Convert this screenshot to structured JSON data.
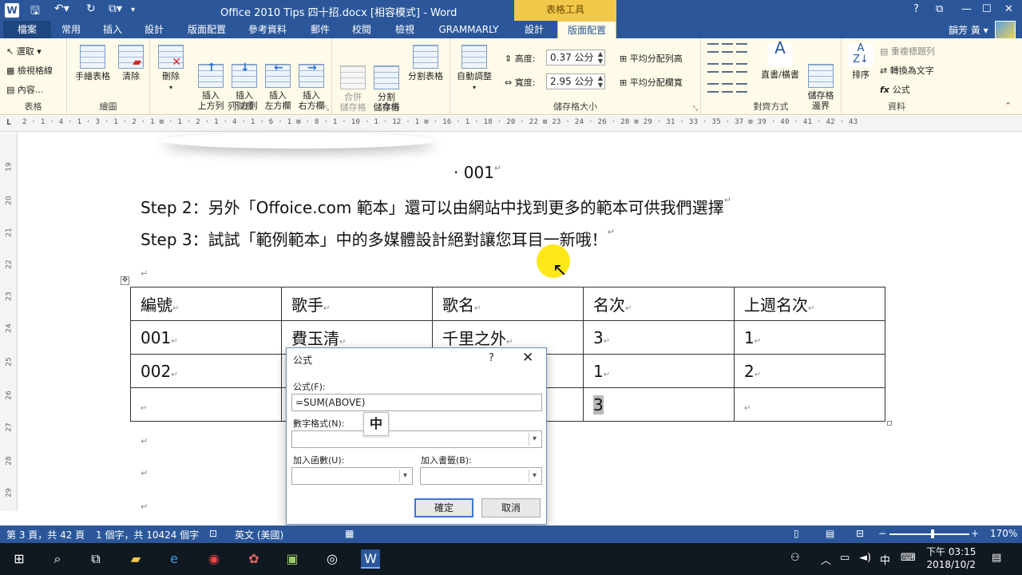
{
  "titlebar": {
    "title": "Office 2010 Tips 四十招.docx [相容模式] - Word",
    "tools_label": "表格工具",
    "help": "?",
    "restore": "⧉",
    "minimize": "—",
    "maximize": "☐",
    "close": "✕"
  },
  "tabs": {
    "file": "檔案",
    "home": "常用",
    "insert": "插入",
    "design": "設計",
    "layout": "版面配置",
    "references": "參考資料",
    "mailings": "郵件",
    "review": "校閱",
    "view": "檢視",
    "grammarly": "GRAMMARLY",
    "table_design": "設計",
    "table_layout": "版面配置",
    "user": "韻芳 黃 ▾"
  },
  "ribbon": {
    "select": "選取 ▾",
    "gridlines": "檢視格線",
    "properties": "內容...",
    "group_table": "表格",
    "draw_table": "手繪表格",
    "eraser": "清除",
    "group_draw": "繪圖",
    "delete": "刪除",
    "insert_above": "插入\n上方列",
    "insert_below": "插入\n下方列",
    "insert_left": "插入\n左方欄",
    "insert_right": "插入\n右方欄",
    "group_rows_cols": "列與欄",
    "merge_cells": "合併\n儲存格",
    "split_cells": "分割\n儲存格",
    "split_table": "分割表格",
    "group_merge": "合併",
    "autofit": "自動調整",
    "height_label": "高度:",
    "height_value": "0.37 公分",
    "width_label": "寬度:",
    "width_value": "2.95 公分",
    "distribute_rows": "平均分配列高",
    "distribute_cols": "平均分配欄寬",
    "group_cell_size": "儲存格大小",
    "text_direction": "直書/橫書",
    "cell_margins": "儲存格\n邊界",
    "group_alignment": "對齊方式",
    "sort": "排序",
    "repeat_header": "重複標題列",
    "convert_text": "轉換為文字",
    "formula": "公式",
    "group_data": "資料"
  },
  "ruler": {
    "text": "2 · 1 · 4 · 1 · 3 · 1 · 2 · 1 ⊞ · 1 · 2 · 1 · 4 · 1 · 6 · 1 ⊞ · 8 · 1 · 10 · 1 · 12 · 1 ⊞ · 16 · 1 · 18 · 20 · 22 ⊞ 23 · 24 · 26 · 28 ⊞ 29 · 31 · 33 · 35 · 37 ⊞ 39 · 40 · 41 · 42 · 43",
    "tab_stop": "L"
  },
  "vruler": [
    "19",
    "20",
    "21",
    "22",
    "23",
    "24",
    "25",
    "26",
    "27",
    "28",
    "29"
  ],
  "doc": {
    "caption": "001",
    "step2": "Step 2：另外「Offoice.com 範本」還可以由網站中找到更多的範本可供我們選擇",
    "step3": "Step 3：試試「範例範本」中的多媒體設計絕對讓您耳目一新哦！",
    "para_mark": "↵"
  },
  "table": {
    "header": [
      "編號",
      "歌手",
      "歌名",
      "名次",
      "上週名次"
    ],
    "rows": [
      [
        "001",
        "費玉清",
        "千里之外",
        "3",
        "1"
      ],
      [
        "002",
        "",
        "",
        "1",
        "2"
      ],
      [
        "",
        "",
        "",
        "3",
        ""
      ]
    ]
  },
  "dialog": {
    "title": "公式",
    "help": "?",
    "close": "✕",
    "formula_label": "公式(F):",
    "formula_value": "=SUM(ABOVE)",
    "number_format_label": "數字格式(N):",
    "number_format_value": "",
    "paste_function_label": "加入函數(U):",
    "paste_bookmark_label": "加入書籤(B):",
    "ok": "確定",
    "cancel": "取消",
    "ime": "中"
  },
  "status": {
    "page": "第 3 頁，共 42 頁",
    "words": "1 個字，共 10424 個字",
    "lang": "英文 (美國)",
    "zoom": "170%"
  },
  "taskbar": {
    "time": "下午 03:15",
    "date": "2018/10/2",
    "ime": "中"
  },
  "colors": {
    "accent": "#2b579a",
    "ribbon_bg": "#fffbe8",
    "tools_tab": "#f2c84a",
    "highlight_cursor": "#ffe600"
  }
}
